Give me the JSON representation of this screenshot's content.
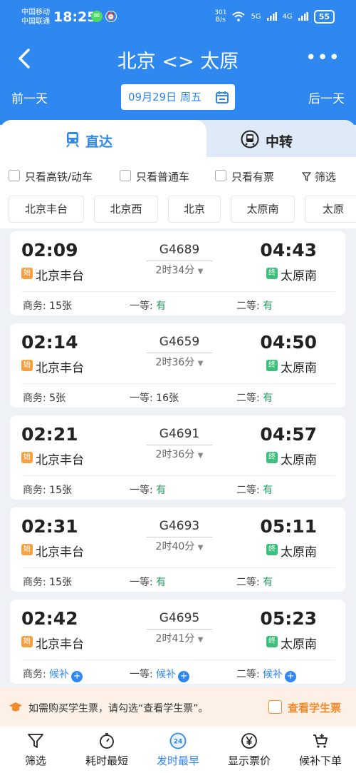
{
  "status_bar": {
    "carrier1": "中国移动",
    "carrier2": "中国联通",
    "time": "18:25",
    "net_speed_value": "301",
    "net_speed_unit": "B/s",
    "signal1": "5G",
    "signal2": "4G",
    "battery": "55"
  },
  "header": {
    "title": "北京 <> 太原",
    "more": "•••",
    "prev_day": "前一天",
    "next_day": "后一天",
    "date": "09月29日 周五"
  },
  "tabs": [
    {
      "label": "直达",
      "active": true
    },
    {
      "label": "中转",
      "active": false
    }
  ],
  "filters": {
    "options": [
      "只看高铁/动车",
      "只看普通车",
      "只看有票"
    ],
    "filter_label": "筛选"
  },
  "stations": [
    "北京丰台",
    "北京西",
    "北京",
    "太原南",
    "太原"
  ],
  "trains": [
    {
      "dep": "02:09",
      "arr": "04:43",
      "train": "G4689",
      "duration": "2时34分",
      "from": "北京丰台",
      "to": "太原南",
      "seats": [
        {
          "label": "商务:",
          "value": "15张",
          "state": "count"
        },
        {
          "label": "一等:",
          "value": "有",
          "state": "yes"
        },
        {
          "label": "二等:",
          "value": "有",
          "state": "yes"
        }
      ]
    },
    {
      "dep": "02:14",
      "arr": "04:50",
      "train": "G4659",
      "duration": "2时36分",
      "from": "北京丰台",
      "to": "太原南",
      "seats": [
        {
          "label": "商务:",
          "value": "5张",
          "state": "count"
        },
        {
          "label": "一等:",
          "value": "16张",
          "state": "count"
        },
        {
          "label": "二等:",
          "value": "有",
          "state": "yes"
        }
      ]
    },
    {
      "dep": "02:21",
      "arr": "04:57",
      "train": "G4691",
      "duration": "2时36分",
      "from": "北京丰台",
      "to": "太原南",
      "seats": [
        {
          "label": "商务:",
          "value": "15张",
          "state": "count"
        },
        {
          "label": "一等:",
          "value": "有",
          "state": "yes"
        },
        {
          "label": "二等:",
          "value": "有",
          "state": "yes"
        }
      ]
    },
    {
      "dep": "02:31",
      "arr": "05:11",
      "train": "G4693",
      "duration": "2时40分",
      "from": "北京丰台",
      "to": "太原南",
      "seats": [
        {
          "label": "商务:",
          "value": "15张",
          "state": "count"
        },
        {
          "label": "一等:",
          "value": "有",
          "state": "yes"
        },
        {
          "label": "二等:",
          "value": "有",
          "state": "yes"
        }
      ]
    },
    {
      "dep": "02:42",
      "arr": "05:23",
      "train": "G4695",
      "duration": "2时41分",
      "from": "北京丰台",
      "to": "太原南",
      "seats": [
        {
          "label": "商务:",
          "value": "候补",
          "state": "waitlist"
        },
        {
          "label": "一等:",
          "value": "候补",
          "state": "waitlist"
        },
        {
          "label": "二等:",
          "value": "候补",
          "state": "waitlist"
        }
      ]
    }
  ],
  "badges": {
    "start": "始",
    "end": "终"
  },
  "notice": {
    "text": "如需购买学生票，请勾选“查看学生票”。",
    "checkbox_label": "查看学生票"
  },
  "bottom_nav": [
    {
      "label": "筛选",
      "icon": "filter-icon",
      "active": false
    },
    {
      "label": "耗时最短",
      "icon": "stopwatch-icon",
      "active": false
    },
    {
      "label": "发时最早",
      "icon": "clock-24-icon",
      "active": true,
      "icon_text": "24"
    },
    {
      "label": "显示票价",
      "icon": "yen-icon",
      "active": false
    },
    {
      "label": "候补下单",
      "icon": "cart-icon",
      "active": false
    }
  ],
  "colors": {
    "primary": "#2f87f0",
    "available": "#1e9e5a",
    "start_badge": "#f5a040",
    "end_badge": "#3cbf7a",
    "notice_bg": "#fdf0e6",
    "student": "#f08a2c"
  }
}
